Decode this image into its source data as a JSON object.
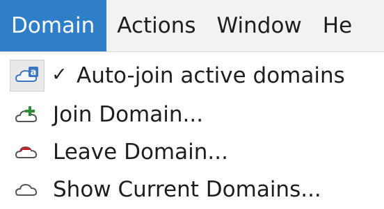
{
  "menubar": {
    "items": [
      {
        "label": "Domain",
        "active": true
      },
      {
        "label": "Actions",
        "active": false
      },
      {
        "label": "Window",
        "active": false
      },
      {
        "label": "He",
        "active": false
      }
    ]
  },
  "domain_menu": {
    "items": [
      {
        "label": "Auto-join active domains",
        "icon": "cloud-a-icon",
        "checkmark": "✓",
        "checked": true
      },
      {
        "label": "Join Domain...",
        "icon": "cloud-plus-icon"
      },
      {
        "label": "Leave Domain...",
        "icon": "cloud-minus-icon"
      },
      {
        "label": "Show Current Domains...",
        "icon": "cloud-icon"
      }
    ]
  },
  "colors": {
    "active_menu_bg": "#2f7fc8",
    "menubar_bg": "#f2f2f2",
    "cloud_blue": "#3a78c4",
    "plus_green": "#2e8b3a",
    "minus_red": "#c02626"
  }
}
